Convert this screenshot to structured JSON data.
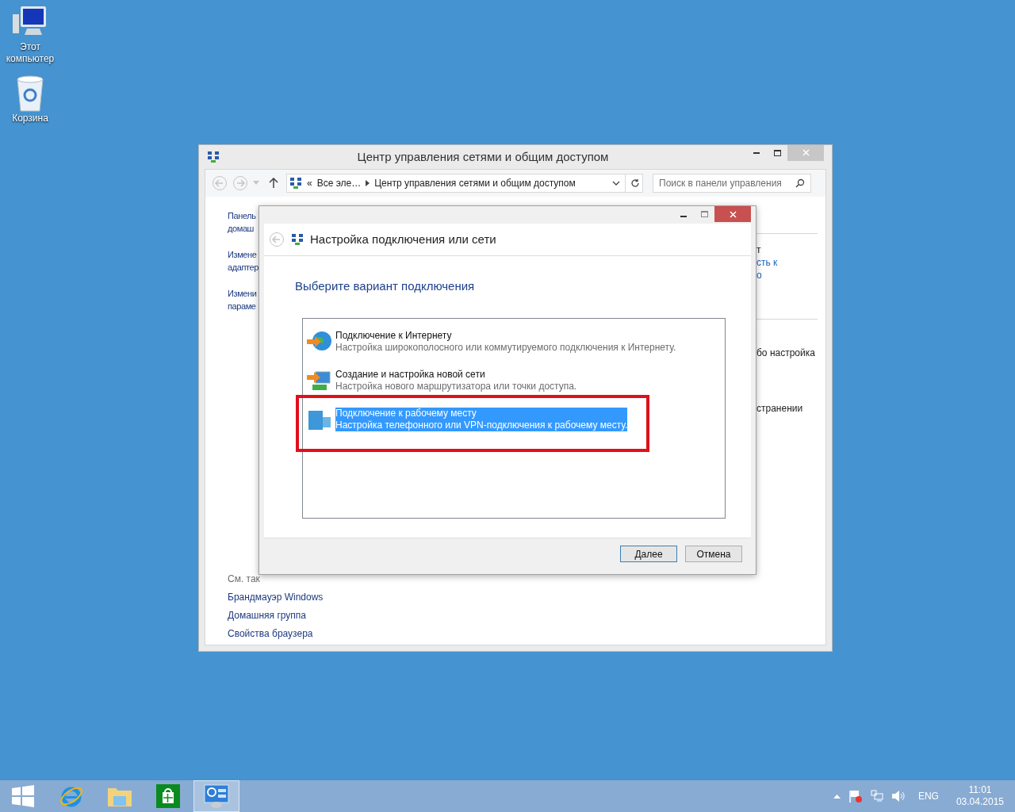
{
  "desktop_icons": [
    {
      "kind": "computer",
      "label": "Этот компьютер"
    },
    {
      "kind": "recycle",
      "label": "Корзина"
    }
  ],
  "main_window": {
    "title": "Центр управления сетями и общим доступом",
    "address": {
      "overflow": "«",
      "crumbs": [
        "Все эле…",
        "Центр управления сетями и общим доступом"
      ]
    },
    "search": {
      "placeholder": "Поиск в панели управления"
    },
    "left_fragments": [
      {
        "kind": "link",
        "lines": [
          "Панель",
          "домаш"
        ]
      },
      {
        "kind": "link",
        "lines": [
          "Измене",
          "адаптер"
        ]
      },
      {
        "kind": "link",
        "lines": [
          "Измени",
          "параме"
        ]
      }
    ],
    "right_fragments": [
      {
        "kind": "text",
        "text": "т"
      },
      {
        "kind": "link",
        "text": "сть к"
      },
      {
        "kind": "link",
        "text": "о"
      },
      {
        "kind": "text",
        "text": "бо настройка"
      },
      {
        "kind": "text",
        "text": "странении"
      }
    ],
    "see_also": {
      "title": "См. так",
      "links": [
        "Брандмауэр Windows",
        "Домашняя группа",
        "Свойства браузера"
      ]
    }
  },
  "dialog": {
    "title": "Настройка подключения или сети",
    "heading": "Выберите вариант подключения",
    "options": [
      {
        "kind": "internet",
        "title": "Подключение к Интернету",
        "description": "Настройка широкополосного или коммутируемого подключения к Интернету.",
        "selected": false,
        "highlighted": false
      },
      {
        "kind": "network",
        "title": "Создание и настройка новой сети",
        "description": "Настройка нового маршрутизатора или точки доступа.",
        "selected": false,
        "highlighted": false
      },
      {
        "kind": "workplace",
        "title": "Подключение к рабочему месту",
        "description": "Настройка телефонного или VPN-подключения к рабочему месту.",
        "selected": true,
        "highlighted": true
      }
    ],
    "buttons": [
      {
        "label": "Далее",
        "default": true
      },
      {
        "label": "Отмена",
        "default": false
      }
    ]
  },
  "taskbar": {
    "apps": [
      {
        "kind": "start",
        "selected": false
      },
      {
        "kind": "browser",
        "selected": false
      },
      {
        "kind": "explorer",
        "selected": false
      },
      {
        "kind": "store",
        "selected": false
      },
      {
        "kind": "control",
        "selected": true
      }
    ],
    "language": "ENG",
    "time": "11:01",
    "date": "03.04.2015"
  }
}
